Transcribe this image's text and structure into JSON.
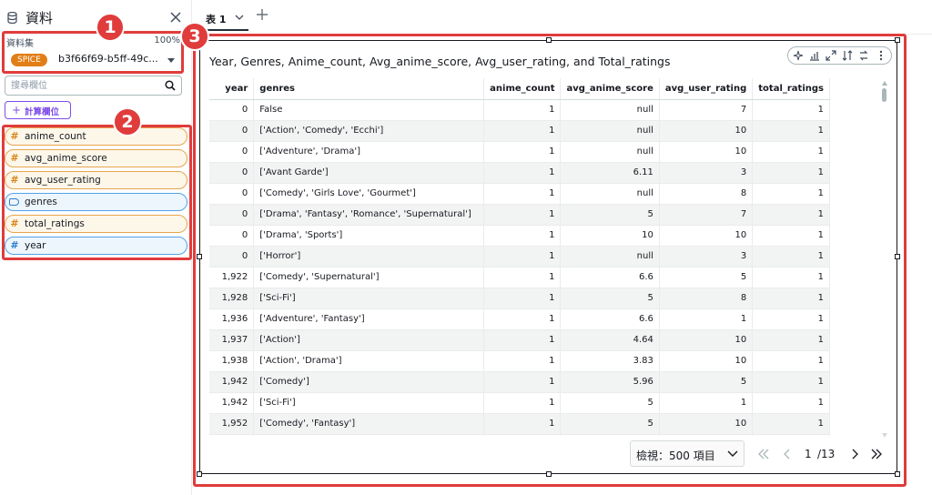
{
  "sidebar": {
    "title": "資料",
    "dataset_label": "資料集",
    "dataset_percent": "100%",
    "dataset_badge": "SPICE",
    "dataset_name": "b3f66f69-b5ff-49c...",
    "search_placeholder": "搜尋欄位",
    "calc_field_label": "計算欄位",
    "fields": [
      {
        "name": "anime_count",
        "kind": "measure",
        "icon": "hash-icon"
      },
      {
        "name": "avg_anime_score",
        "kind": "measure",
        "icon": "hash-icon"
      },
      {
        "name": "avg_user_rating",
        "kind": "measure",
        "icon": "hash-icon"
      },
      {
        "name": "genres",
        "kind": "dimension",
        "icon": "tag-icon"
      },
      {
        "name": "total_ratings",
        "kind": "measure",
        "icon": "hash-icon"
      },
      {
        "name": "year",
        "kind": "dimension",
        "icon": "hash-icon"
      }
    ]
  },
  "tabs": [
    {
      "label": "表 1"
    }
  ],
  "visual": {
    "title": "Year, Genres, Anime_count, Avg_anime_score, Avg_user_rating, and Total_ratings",
    "toolbar_icons": [
      "sparkle-icon",
      "chart-type-icon",
      "expand-icon",
      "sort-icon",
      "swap-icon",
      "more-icon"
    ],
    "table": {
      "columns": [
        "year",
        "genres",
        "anime_count",
        "avg_anime_score",
        "avg_user_rating",
        "total_ratings"
      ],
      "rows": [
        [
          "0",
          "False",
          "1",
          "null",
          "7",
          "1"
        ],
        [
          "0",
          "['Action', 'Comedy', 'Ecchi']",
          "1",
          "null",
          "10",
          "1"
        ],
        [
          "0",
          "['Adventure', 'Drama']",
          "1",
          "null",
          "10",
          "1"
        ],
        [
          "0",
          "['Avant Garde']",
          "1",
          "6.11",
          "3",
          "1"
        ],
        [
          "0",
          "['Comedy', 'Girls Love', 'Gourmet']",
          "1",
          "null",
          "8",
          "1"
        ],
        [
          "0",
          "['Drama', 'Fantasy', 'Romance', 'Supernatural']",
          "1",
          "5",
          "7",
          "1"
        ],
        [
          "0",
          "['Drama', 'Sports']",
          "1",
          "10",
          "10",
          "1"
        ],
        [
          "0",
          "['Horror']",
          "1",
          "null",
          "3",
          "1"
        ],
        [
          "1,922",
          "['Comedy', 'Supernatural']",
          "1",
          "6.6",
          "5",
          "1"
        ],
        [
          "1,928",
          "['Sci-Fi']",
          "1",
          "5",
          "8",
          "1"
        ],
        [
          "1,936",
          "['Adventure', 'Fantasy']",
          "1",
          "6.6",
          "1",
          "1"
        ],
        [
          "1,937",
          "['Action']",
          "1",
          "4.64",
          "10",
          "1"
        ],
        [
          "1,938",
          "['Action', 'Drama']",
          "1",
          "3.83",
          "10",
          "1"
        ],
        [
          "1,942",
          "['Comedy']",
          "1",
          "5.96",
          "5",
          "1"
        ],
        [
          "1,942",
          "['Sci-Fi']",
          "1",
          "5",
          "1",
          "1"
        ],
        [
          "1,952",
          "['Comedy', 'Fantasy']",
          "1",
          "5",
          "10",
          "1"
        ],
        [
          "",
          "",
          "",
          "",
          "",
          ""
        ]
      ]
    },
    "pagination": {
      "page_size_label": "檢視：500 項目",
      "current_page": "1",
      "total_pages": "/13"
    }
  },
  "annotations": [
    {
      "label": "1"
    },
    {
      "label": "2"
    },
    {
      "label": "3"
    }
  ],
  "colors": {
    "annotation": "#e03c3c",
    "spice": "#e27e17",
    "measure_field": "#e5a54b",
    "dimension_field": "#4fa3e8",
    "accent": "#7d4ce8"
  }
}
